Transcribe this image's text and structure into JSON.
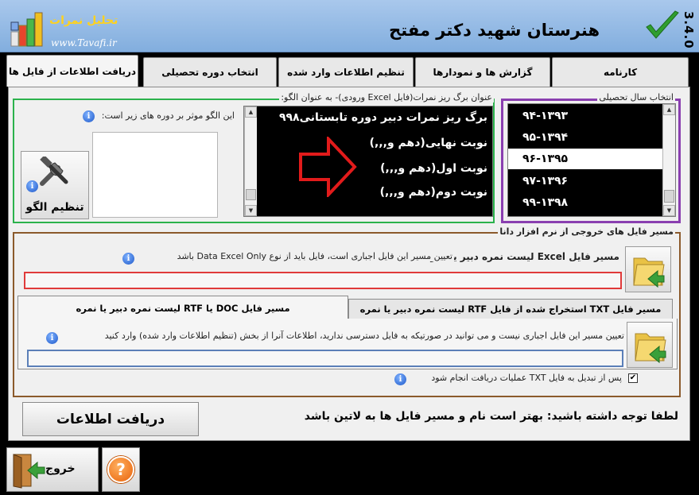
{
  "app": {
    "title": "هنرستان شهید دکتر مفتح",
    "version": "3.4.0",
    "logo_text": "تحلیل نمرات",
    "logo_url": "www.Tavafi.ir"
  },
  "tabs": [
    {
      "label": "دریافت اطلاعات از فایل ها",
      "active": true
    },
    {
      "label": "انتخاب دوره تحصیلی",
      "active": false
    },
    {
      "label": "تنظیم اطلاعات وارد شده",
      "active": false
    },
    {
      "label": "گزارش ها و نمودارها",
      "active": false
    },
    {
      "label": "کارنامه",
      "active": false
    }
  ],
  "pattern": {
    "group_label": "عنوان برگ ریز نمرات(فایل Excel ورودی)- به عنوان الگو:",
    "lines": [
      "برگ ریز نمرات دبیر دوره تابستانی۹۹۸",
      "نوبت نهایی(دهم و,,,)",
      "نوبت اول(دهم و,,,)",
      "نوبت دوم(دهم و,,,)"
    ],
    "applies_label": "این الگو موثر بر دوره های زیر است:",
    "settings_button": "تنظیم الگو"
  },
  "year_select": {
    "label": "انتخاب سال تحصیلی",
    "years": [
      "۹۴-۱۳۹۳",
      "۹۵-۱۳۹۴",
      "۹۶-۱۳۹۵",
      "۹۷-۱۳۹۶",
      "۹۹-۱۳۹۸"
    ],
    "selected_index": 2
  },
  "output": {
    "group_label": "مسیر فایل های خروجی از نرم افزار دانا",
    "excel_title": "مسیر فایل Excel لیست نمره دبیر یا نمره",
    "excel_hint": "تعیین مسیر این فایل اجباری است، فایل باید از نوع Data Excel Only باشد",
    "excel_path": "",
    "subtab_txt": "مسیر فایل TXT استخراج شده از فایل RTF لیست نمره دبیر یا نمره",
    "subtab_doc": "مسیر فایل DOC یا RTF لیست نمره دبیر یا نمره",
    "txt_hint": "تعیین مسیر این فایل اجباری نیست و می توانید در صورتیکه به فایل دسترسی ندارید، اطلاعات آنرا از بخش (تنظیم اطلاعات وارد شده) وارد کنید",
    "txt_path": "",
    "checkbox_label": "پس از تبدیل به فایل TXT عملیات دریافت انجام شود",
    "checkbox_checked": true
  },
  "actions": {
    "receive_button": "دریافت اطلاعات",
    "note": "لطفا توجه داشته باشید: بهتر است نام و مسیر فایل ها به لاتین باشد",
    "exit_button": "خروج",
    "help_symbol": "?",
    "info_symbol": "i"
  },
  "colors": {
    "header": "#92b7e4",
    "group_pattern": "#2bb24c",
    "group_year": "#8a3fb0",
    "group_output": "#8b5a2b",
    "excel_field_border": "#e03a3a",
    "txt_field_border": "#5b7fb8",
    "arrow": "#e21b1b"
  }
}
